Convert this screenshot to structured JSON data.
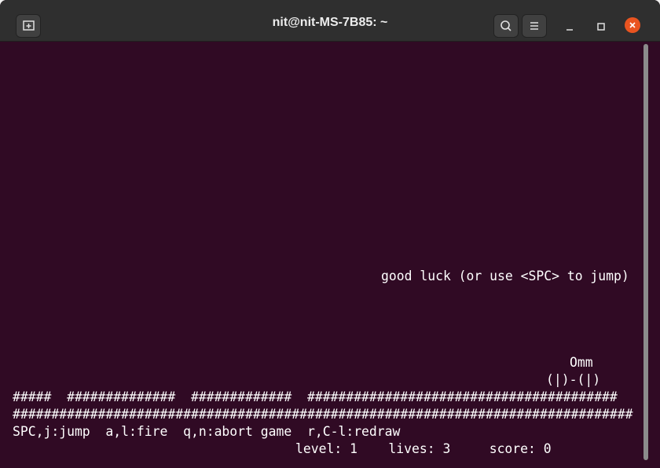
{
  "window": {
    "title": "nit@nit-MS-7B85: ~",
    "icons": [
      "new-tab-icon",
      "search-icon",
      "menu-icon",
      "minimize-icon",
      "maximize-icon",
      "close-icon"
    ],
    "colors": {
      "terminal_bg": "#300a24",
      "titlebar_bg": "#2f2f2f",
      "close": "#e95420",
      "text": "#ffffff"
    }
  },
  "terminal": {
    "message": "good luck (or use <SPC> to jump)",
    "player_head": "Omm",
    "player_body": "(|)-(|)",
    "ground_row1": "#####  ##############  #############  ########################################",
    "ground_row2": "################################################################################",
    "help_line": "SPC,j:jump  a,l:fire  q,n:abort game  r,C-l:redraw",
    "status_line": "level: 1    lives: 3     score: 0"
  }
}
